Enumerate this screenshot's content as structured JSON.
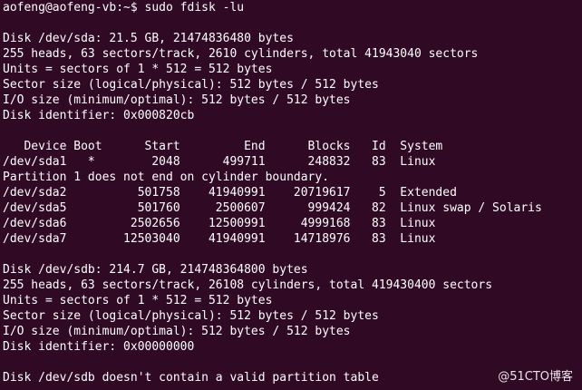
{
  "terminal": {
    "lines": [
      "aofeng@aofeng-vb:~$ sudo fdisk -lu",
      "",
      "Disk /dev/sda: 21.5 GB, 21474836480 bytes",
      "255 heads, 63 sectors/track, 2610 cylinders, total 41943040 sectors",
      "Units = sectors of 1 * 512 = 512 bytes",
      "Sector size (logical/physical): 512 bytes / 512 bytes",
      "I/O size (minimum/optimal): 512 bytes / 512 bytes",
      "Disk identifier: 0x000820cb",
      "",
      "   Device Boot      Start         End      Blocks   Id  System",
      "/dev/sda1   *        2048      499711      248832   83  Linux",
      "Partition 1 does not end on cylinder boundary.",
      "/dev/sda2          501758    41940991    20719617    5  Extended",
      "/dev/sda5          501760     2500607      999424   82  Linux swap / Solaris",
      "/dev/sda6         2502656    12500991     4999168   83  Linux",
      "/dev/sda7        12503040    41940991    14718976   83  Linux",
      "",
      "Disk /dev/sdb: 214.7 GB, 214748364800 bytes",
      "255 heads, 63 sectors/track, 26108 cylinders, total 419430400 sectors",
      "Units = sectors of 1 * 512 = 512 bytes",
      "Sector size (logical/physical): 512 bytes / 512 bytes",
      "I/O size (minimum/optimal): 512 bytes / 512 bytes",
      "Disk identifier: 0x00000000",
      "",
      "Disk /dev/sdb doesn't contain a valid partition table"
    ],
    "background_color": "#300a24",
    "text_color": "#ffffff"
  },
  "watermark": {
    "text": "@51CTO博客"
  }
}
